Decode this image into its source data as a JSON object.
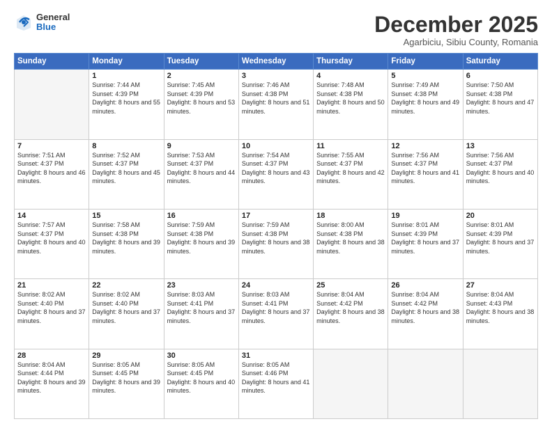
{
  "logo": {
    "general": "General",
    "blue": "Blue"
  },
  "title": "December 2025",
  "location": "Agarbiciu, Sibiu County, Romania",
  "days_header": [
    "Sunday",
    "Monday",
    "Tuesday",
    "Wednesday",
    "Thursday",
    "Friday",
    "Saturday"
  ],
  "weeks": [
    [
      {
        "day": "",
        "empty": true
      },
      {
        "day": "1",
        "sunrise": "7:44 AM",
        "sunset": "4:39 PM",
        "daylight": "8 hours and 55 minutes."
      },
      {
        "day": "2",
        "sunrise": "7:45 AM",
        "sunset": "4:39 PM",
        "daylight": "8 hours and 53 minutes."
      },
      {
        "day": "3",
        "sunrise": "7:46 AM",
        "sunset": "4:38 PM",
        "daylight": "8 hours and 51 minutes."
      },
      {
        "day": "4",
        "sunrise": "7:48 AM",
        "sunset": "4:38 PM",
        "daylight": "8 hours and 50 minutes."
      },
      {
        "day": "5",
        "sunrise": "7:49 AM",
        "sunset": "4:38 PM",
        "daylight": "8 hours and 49 minutes."
      },
      {
        "day": "6",
        "sunrise": "7:50 AM",
        "sunset": "4:38 PM",
        "daylight": "8 hours and 47 minutes."
      }
    ],
    [
      {
        "day": "7",
        "sunrise": "7:51 AM",
        "sunset": "4:37 PM",
        "daylight": "8 hours and 46 minutes."
      },
      {
        "day": "8",
        "sunrise": "7:52 AM",
        "sunset": "4:37 PM",
        "daylight": "8 hours and 45 minutes."
      },
      {
        "day": "9",
        "sunrise": "7:53 AM",
        "sunset": "4:37 PM",
        "daylight": "8 hours and 44 minutes."
      },
      {
        "day": "10",
        "sunrise": "7:54 AM",
        "sunset": "4:37 PM",
        "daylight": "8 hours and 43 minutes."
      },
      {
        "day": "11",
        "sunrise": "7:55 AM",
        "sunset": "4:37 PM",
        "daylight": "8 hours and 42 minutes."
      },
      {
        "day": "12",
        "sunrise": "7:56 AM",
        "sunset": "4:37 PM",
        "daylight": "8 hours and 41 minutes."
      },
      {
        "day": "13",
        "sunrise": "7:56 AM",
        "sunset": "4:37 PM",
        "daylight": "8 hours and 40 minutes."
      }
    ],
    [
      {
        "day": "14",
        "sunrise": "7:57 AM",
        "sunset": "4:37 PM",
        "daylight": "8 hours and 40 minutes."
      },
      {
        "day": "15",
        "sunrise": "7:58 AM",
        "sunset": "4:38 PM",
        "daylight": "8 hours and 39 minutes."
      },
      {
        "day": "16",
        "sunrise": "7:59 AM",
        "sunset": "4:38 PM",
        "daylight": "8 hours and 39 minutes."
      },
      {
        "day": "17",
        "sunrise": "7:59 AM",
        "sunset": "4:38 PM",
        "daylight": "8 hours and 38 minutes."
      },
      {
        "day": "18",
        "sunrise": "8:00 AM",
        "sunset": "4:38 PM",
        "daylight": "8 hours and 38 minutes."
      },
      {
        "day": "19",
        "sunrise": "8:01 AM",
        "sunset": "4:39 PM",
        "daylight": "8 hours and 37 minutes."
      },
      {
        "day": "20",
        "sunrise": "8:01 AM",
        "sunset": "4:39 PM",
        "daylight": "8 hours and 37 minutes."
      }
    ],
    [
      {
        "day": "21",
        "sunrise": "8:02 AM",
        "sunset": "4:40 PM",
        "daylight": "8 hours and 37 minutes."
      },
      {
        "day": "22",
        "sunrise": "8:02 AM",
        "sunset": "4:40 PM",
        "daylight": "8 hours and 37 minutes."
      },
      {
        "day": "23",
        "sunrise": "8:03 AM",
        "sunset": "4:41 PM",
        "daylight": "8 hours and 37 minutes."
      },
      {
        "day": "24",
        "sunrise": "8:03 AM",
        "sunset": "4:41 PM",
        "daylight": "8 hours and 37 minutes."
      },
      {
        "day": "25",
        "sunrise": "8:04 AM",
        "sunset": "4:42 PM",
        "daylight": "8 hours and 38 minutes."
      },
      {
        "day": "26",
        "sunrise": "8:04 AM",
        "sunset": "4:42 PM",
        "daylight": "8 hours and 38 minutes."
      },
      {
        "day": "27",
        "sunrise": "8:04 AM",
        "sunset": "4:43 PM",
        "daylight": "8 hours and 38 minutes."
      }
    ],
    [
      {
        "day": "28",
        "sunrise": "8:04 AM",
        "sunset": "4:44 PM",
        "daylight": "8 hours and 39 minutes."
      },
      {
        "day": "29",
        "sunrise": "8:05 AM",
        "sunset": "4:45 PM",
        "daylight": "8 hours and 39 minutes."
      },
      {
        "day": "30",
        "sunrise": "8:05 AM",
        "sunset": "4:45 PM",
        "daylight": "8 hours and 40 minutes."
      },
      {
        "day": "31",
        "sunrise": "8:05 AM",
        "sunset": "4:46 PM",
        "daylight": "8 hours and 41 minutes."
      },
      {
        "day": "",
        "empty": true
      },
      {
        "day": "",
        "empty": true
      },
      {
        "day": "",
        "empty": true
      }
    ]
  ],
  "labels": {
    "sunrise": "Sunrise:",
    "sunset": "Sunset:",
    "daylight": "Daylight:"
  }
}
